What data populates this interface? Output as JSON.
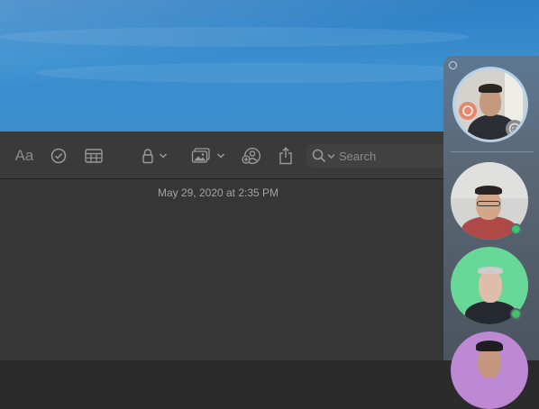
{
  "note": {
    "timestamp": "May 29, 2020 at 2:35 PM"
  },
  "toolbar": {
    "format_label": "Aa",
    "search_placeholder": "Search",
    "icons": [
      "format-text-icon",
      "checklist-icon",
      "table-icon",
      "lock-icon",
      "chevron-down-icon",
      "media-icon",
      "chevron-down-icon",
      "collaborate-icon",
      "share-icon",
      "search-icon",
      "chevron-down-icon"
    ]
  },
  "facetime": {
    "participants": [
      "self-video",
      "participant-2",
      "participant-3",
      "participant-4"
    ],
    "colors": {
      "accent_ring": "#b9d2ea",
      "online": "#3cc76a",
      "tile3_bg": "#69dc9a",
      "tile4_bg": "#c08ad8"
    }
  }
}
